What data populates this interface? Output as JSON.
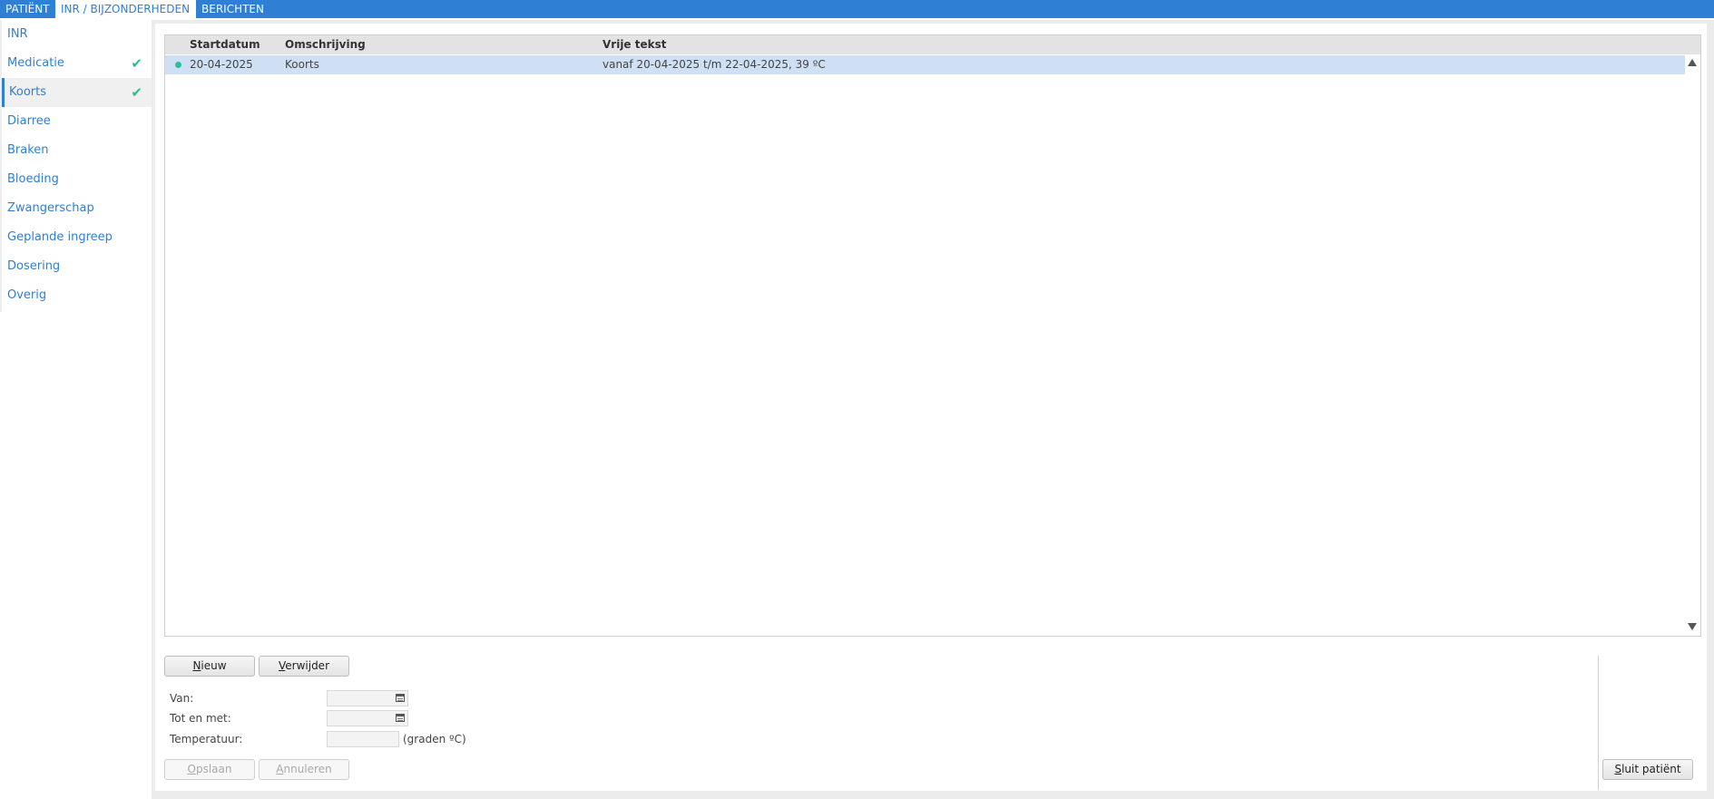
{
  "topbar": {
    "tabs": [
      "PATIËNT",
      "INR / BIJZONDERHEDEN",
      "BERICHTEN"
    ]
  },
  "sidebar": {
    "items": [
      {
        "label": "INR",
        "checked": false
      },
      {
        "label": "Medicatie",
        "checked": true
      },
      {
        "label": "Koorts",
        "checked": true,
        "active": true
      },
      {
        "label": "Diarree",
        "checked": false
      },
      {
        "label": "Braken",
        "checked": false
      },
      {
        "label": "Bloeding",
        "checked": false
      },
      {
        "label": "Zwangerschap",
        "checked": false
      },
      {
        "label": "Geplande ingreep",
        "checked": false
      },
      {
        "label": "Dosering",
        "checked": false
      },
      {
        "label": "Overig",
        "checked": false
      }
    ],
    "check_glyph": "✔",
    "check_color": "#2bbf8a"
  },
  "grid": {
    "columns": [
      "Startdatum",
      "Omschrijving",
      "Vrije tekst"
    ],
    "rows": [
      {
        "startdatum": "20-04-2025",
        "omschrijving": "Koorts",
        "vrije_tekst": "vanaf 20-04-2025 t/m 22-04-2025, 39 ºC"
      }
    ]
  },
  "buttons": {
    "nieuw": {
      "first": "N",
      "rest": "ieuw"
    },
    "verwijder": {
      "first": "V",
      "rest": "erwijder"
    },
    "opslaan": {
      "first": "O",
      "rest": "pslaan"
    },
    "annuleren": {
      "first": "A",
      "rest": "nnuleren"
    },
    "sluit": {
      "first": "S",
      "rest": "luit patiënt"
    }
  },
  "form": {
    "van_label": "Van:",
    "van_value": "",
    "tot_label": "Tot en met:",
    "tot_value": "",
    "temp_label": "Temperatuur:",
    "temp_value": "",
    "temp_unit": "(graden ºC)"
  },
  "colors": {
    "accent": "#2f7fd4",
    "selected_row": "#cfe0f5",
    "status_dot": "#2bbf9a"
  }
}
